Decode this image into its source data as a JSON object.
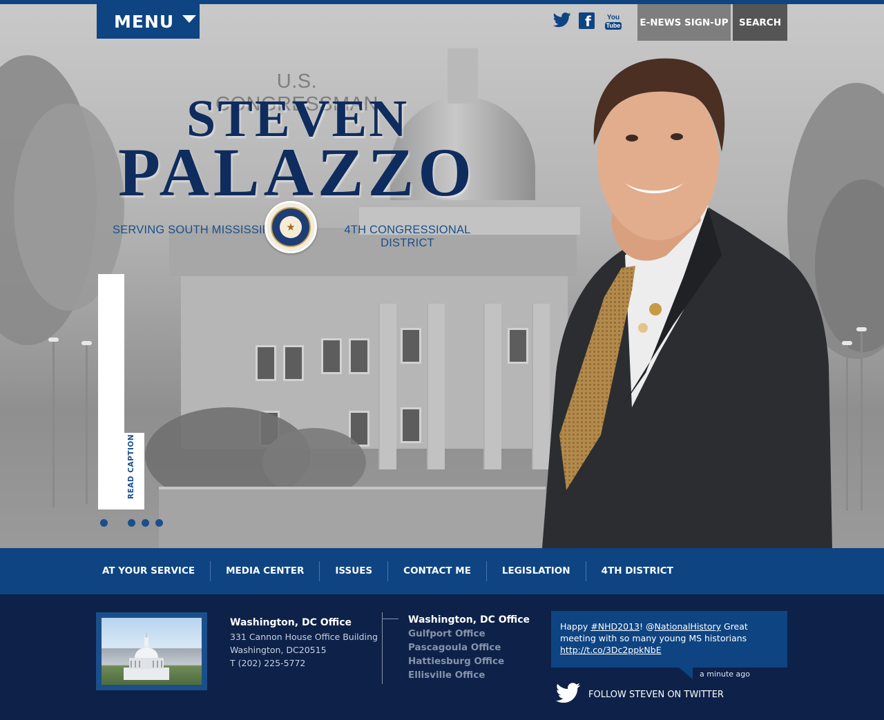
{
  "header": {
    "menu_label": "MENU",
    "social": [
      "twitter-icon",
      "facebook-icon",
      "youtube-icon"
    ],
    "facebook_glyph": "f",
    "youtube_top": "You",
    "youtube_bottom": "Tube",
    "enews_label": "E-NEWS SIGN-UP",
    "search_label": "SEARCH"
  },
  "hero": {
    "kicker": "U.S. CONGRESSMAN",
    "first_name": "STEVEN",
    "last_name": "PALAZZO",
    "serving_left": "SERVING SOUTH MISSISSIPPI'S",
    "serving_right": "4TH CONGRESSIONAL DISTRICT",
    "caption_label": "READ CAPTION",
    "slides": 4,
    "active_slide": 1
  },
  "nav": {
    "items": [
      "AT YOUR SERVICE",
      "MEDIA CENTER",
      "ISSUES",
      "CONTACT ME",
      "LEGISLATION",
      "4TH DISTRICT"
    ]
  },
  "footer": {
    "office": {
      "title": "Washington, DC Office",
      "address1": "331 Cannon House Office Building",
      "address2": "Washington, DC20515",
      "phone": "T (202) 225-5772"
    },
    "offices": [
      "Washington, DC Office",
      "Gulfport Office",
      "Pascagoula Office",
      "Hattiesburg Office",
      "Ellisville Office"
    ],
    "tweet": {
      "pre": "Happy ",
      "hashtag": "#NHD2013",
      "mid": "! @",
      "mention": "NationalHistory",
      "post": " Great meeting with so many young MS historians",
      "link": "http://t.co/3Dc2ppkNbE",
      "time": "a minute ago"
    },
    "follow_label": "FOLLOW STEVEN ON TWITTER"
  },
  "colors": {
    "brand_blue": "#0e4482",
    "navy": "#0d2149",
    "name_navy": "#0f2c5e",
    "enews_gray": "#7e7e7e",
    "search_gray": "#555555"
  }
}
